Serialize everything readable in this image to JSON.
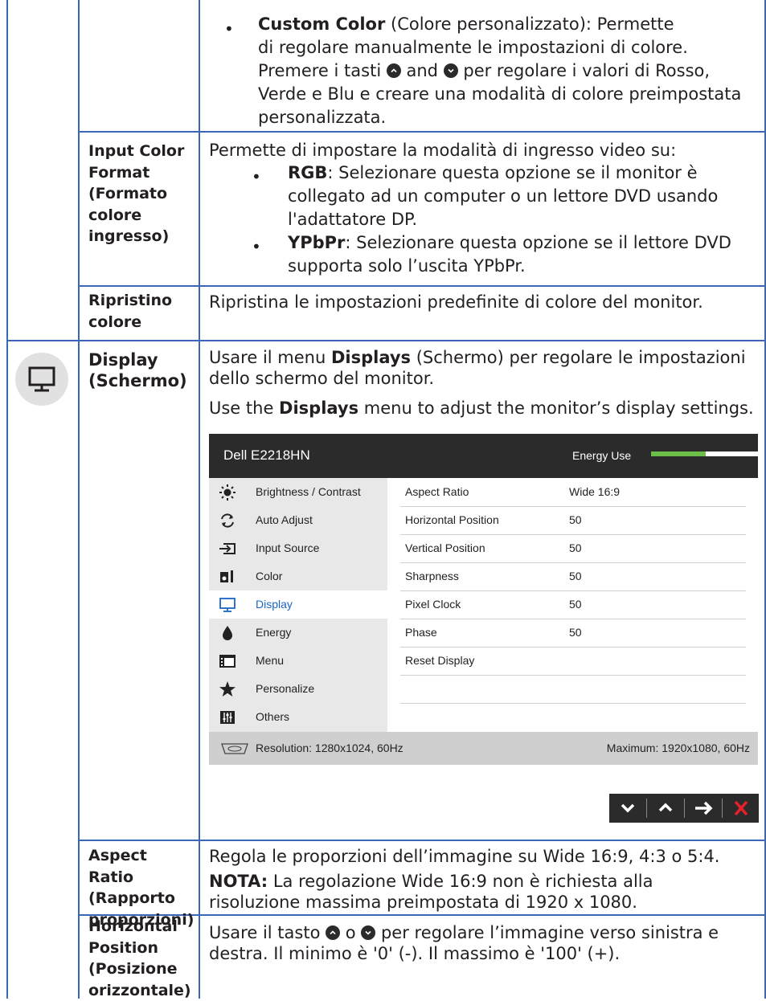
{
  "custom_color": {
    "term": "Custom Color",
    "line1": " (Colore personalizzato): Permette",
    "line2": "di regolare manualmente le impostazioni di colore.",
    "line3a": "Premere i tasti ",
    "line3b": " and ",
    "line3c": " per regolare i valori di Rosso,",
    "line4": "Verde e Blu e creare una modalità di colore preimpostata",
    "line5": "personalizzata."
  },
  "input_color": {
    "label": [
      "Input Color",
      "Format",
      "(Formato",
      "colore",
      "ingresso)"
    ],
    "intro": "Permette di impostare la modalità di ingresso video su:",
    "rgb_term": "RGB",
    "rgb_l1": ": Selezionare questa opzione se il monitor è",
    "rgb_l2": "collegato ad un computer o un lettore DVD usando",
    "rgb_l3": "l'adattatore DP.",
    "ypbpr_term": "YPbPr",
    "ypbpr_l1": ": Selezionare questa opzione se il lettore DVD",
    "ypbpr_l2": "supporta solo l’uscita YPbPr."
  },
  "reset_color": {
    "label": [
      "Ripristino",
      "colore"
    ],
    "text": "Ripristina le impostazioni predefinite di colore del monitor."
  },
  "display": {
    "label": [
      "Display",
      "(Schermo)"
    ],
    "l1a": "Usare il menu ",
    "l1term": "Displays",
    "l1b": " (Schermo) per regolare le impostazioni",
    "l2": "dello schermo del monitor.",
    "l3a": "Use the ",
    "l3term": "Displays",
    "l3b": " menu to adjust the monitor’s display settings."
  },
  "osd": {
    "title": "Dell E2218HN",
    "energy_label": "Energy Use",
    "energy_level": 0.51,
    "menu": [
      "Brightness / Contrast",
      "Auto Adjust",
      "Input Source",
      "Color",
      "Display",
      "Energy",
      "Menu",
      "Personalize",
      "Others"
    ],
    "selected": "Display",
    "rows": [
      {
        "k": "Aspect Ratio",
        "v": "Wide 16:9"
      },
      {
        "k": "Horizontal Position",
        "v": "50"
      },
      {
        "k": "Vertical Position",
        "v": "50"
      },
      {
        "k": "Sharpness",
        "v": "50"
      },
      {
        "k": "Pixel Clock",
        "v": "50"
      },
      {
        "k": "Phase",
        "v": "50"
      },
      {
        "k": "Reset Display",
        "v": ""
      }
    ],
    "resolution": "Resolution: 1280x1024, 60Hz",
    "maximum": "Maximum: 1920x1080, 60Hz"
  },
  "aspect": {
    "label": [
      "Aspect Ratio",
      "(Rapporto",
      "proporzioni)"
    ],
    "l1": "Regola le proporzioni dell’immagine su Wide 16:9, 4:3 o 5:4.",
    "note_term": "NOTA:",
    "l2": " La regolazione Wide 16:9 non è richiesta alla",
    "l3": "risoluzione massima preimpostata di 1920 x 1080."
  },
  "hpos": {
    "label": [
      "Horizontal",
      "Position",
      "(Posizione",
      "orizzontale)"
    ],
    "l1a": "Usare il tasto ",
    "l1b": " o ",
    "l1c": " per regolare l’immagine verso sinistra e",
    "l2": "destra. Il minimo è '0' (-). Il massimo è '100' (+)."
  }
}
